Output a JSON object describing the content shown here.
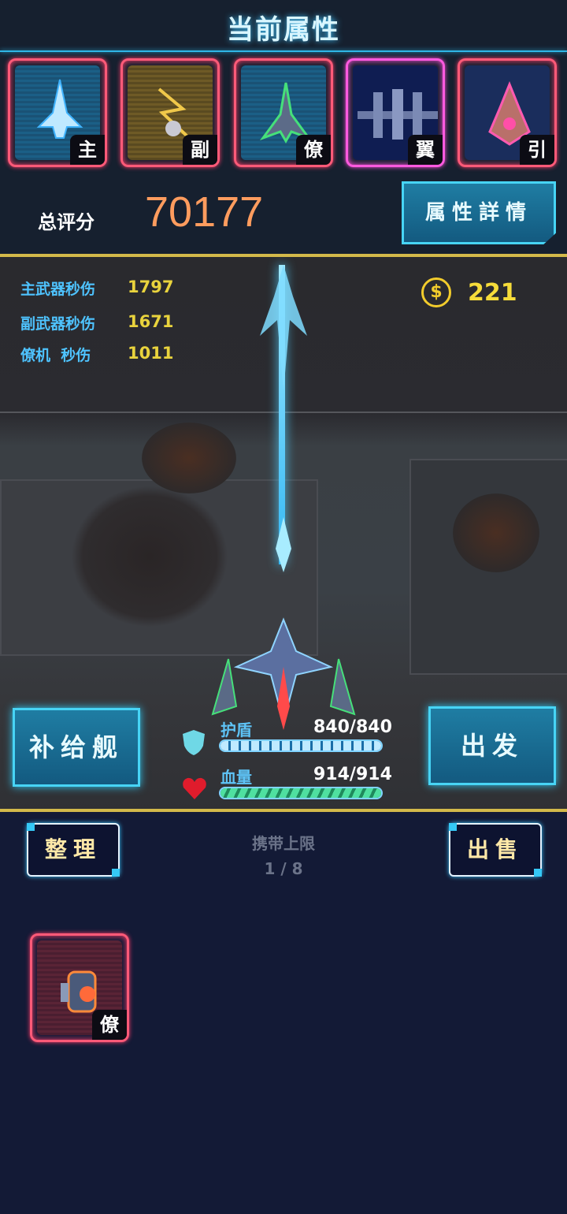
{
  "header": {
    "title": "当前属性"
  },
  "slots": [
    {
      "tag": "主",
      "frame_color": "#ff5a78",
      "art": "main-weapon-ship-icon"
    },
    {
      "tag": "副",
      "frame_color": "#ff5a78",
      "art": "sub-weapon-icon"
    },
    {
      "tag": "僚",
      "frame_color": "#ff5a78",
      "art": "wingman-ship-icon"
    },
    {
      "tag": "翼",
      "frame_color": "#ff5ae0",
      "art": "wing-icon"
    },
    {
      "tag": "引",
      "frame_color": "#ff5a78",
      "art": "engine-icon"
    }
  ],
  "score": {
    "label": "总评分",
    "value": "70177"
  },
  "detail_button": "属性詳情",
  "stats": [
    {
      "label": "主武器秒伤",
      "value": "1797"
    },
    {
      "label": "副武器秒伤",
      "value": "1671"
    },
    {
      "label": "僚机  秒伤",
      "value": "1011"
    }
  ],
  "coins": {
    "value": "221"
  },
  "actions": {
    "supply": "补给舰",
    "depart": "出发"
  },
  "shield": {
    "label": "护盾",
    "value": "840/840",
    "fraction": 1.0
  },
  "hp": {
    "label": "血量",
    "value": "914/914",
    "fraction": 1.0
  },
  "bottom": {
    "organize": "整理",
    "sell": "出售",
    "carry_label": "携带上限",
    "carry_value": "1 / 8"
  },
  "inventory": [
    {
      "tag": "僚",
      "art": "wingman-drone-icon"
    }
  ],
  "colors": {
    "accent": "#47d4f5",
    "score": "#ff9c5e",
    "gold": "#f2cc2c",
    "frame": "#ff5a78",
    "bg": "#131a36"
  }
}
